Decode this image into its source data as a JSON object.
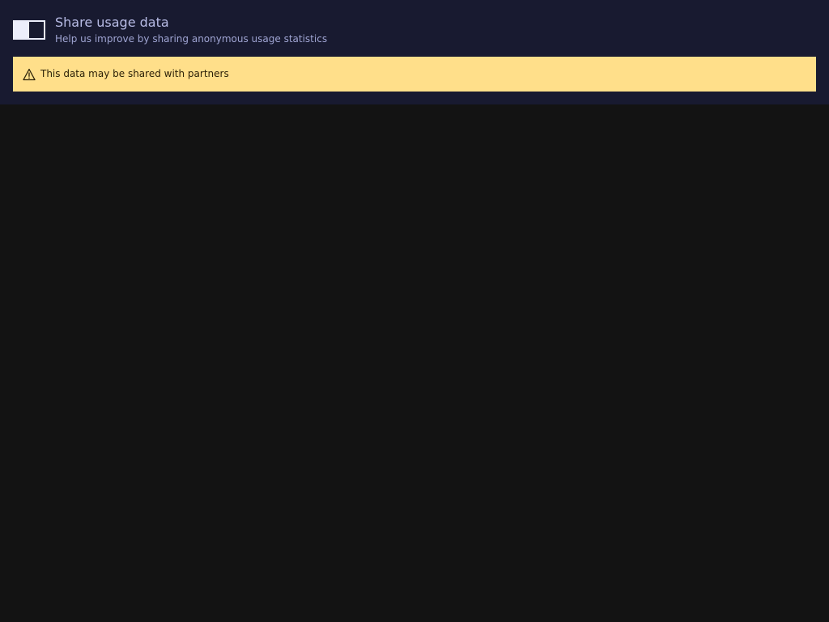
{
  "usage_setting": {
    "title": "Share usage data",
    "description": "Help us improve by sharing anonymous usage statistics",
    "toggle_state": "off"
  },
  "warning": {
    "icon": "warning-triangle-icon",
    "text": "This data may be shared with partners"
  },
  "colors": {
    "panel_background": "#181a30",
    "page_background": "#131313",
    "warning_background": "#ffdf8a",
    "title_text": "#b8bce6",
    "toggle": "#eceefb"
  }
}
